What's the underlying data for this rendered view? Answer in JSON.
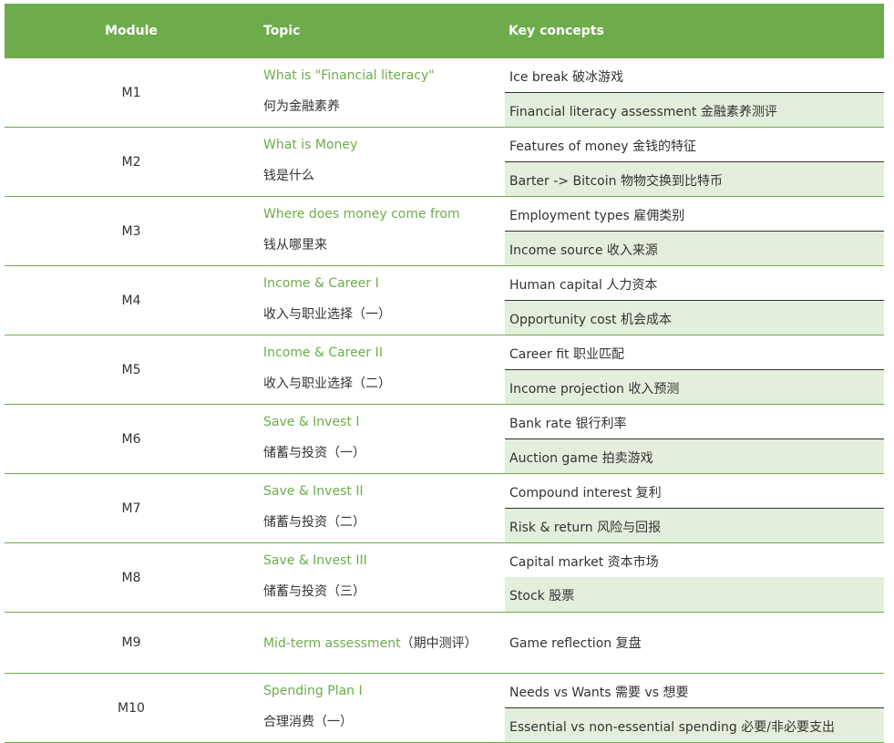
{
  "header": {
    "module": "Module",
    "topic": "Topic",
    "concepts": "Key concepts"
  },
  "rows": [
    {
      "module": "M1",
      "topic_en": "What is \"Financial literacy\"",
      "topic_zh": "何为金融素养",
      "concept1": "Ice break 破冰游戏",
      "concept2": "Financial literacy assessment 金融素养测评"
    },
    {
      "module": "M2",
      "topic_en": "What is Money",
      "topic_zh": "钱是什么",
      "concept1": "Features of money 金钱的特征",
      "concept2": "Barter -> Bitcoin 物物交换到比特币"
    },
    {
      "module": "M3",
      "topic_en": "Where does money come from",
      "topic_zh": "钱从哪里来",
      "concept1": "Employment types 雇佣类别",
      "concept2": "Income source 收入来源"
    },
    {
      "module": "M4",
      "topic_en": "Income & Career I",
      "topic_zh": "收入与职业选择（一）",
      "concept1": "Human capital 人力资本",
      "concept2": "Opportunity cost 机会成本"
    },
    {
      "module": "M5",
      "topic_en": "Income & Career II",
      "topic_zh": "收入与职业选择（二）",
      "concept1": "Career fit 职业匹配",
      "concept2": "Income projection 收入预测"
    },
    {
      "module": "M6",
      "topic_en": "Save & Invest I",
      "topic_zh": "储蓄与投资（一）",
      "concept1": "Bank rate 银行利率",
      "concept2": "Auction game 拍卖游戏"
    },
    {
      "module": "M7",
      "topic_en": "Save & Invest II",
      "topic_zh": "储蓄与投资（二）",
      "concept1": "Compound interest 复利",
      "concept2": "Risk & return 风险与回报"
    },
    {
      "module": "M8",
      "topic_en": "Save & Invest III",
      "topic_zh": "储蓄与投资（三）",
      "concept1": "Capital market 资本市场",
      "concept2": "Stock 股票"
    },
    {
      "module": "M9",
      "topic_en": "Mid-term assessment",
      "topic_zh": "（期中测评）",
      "concept1": "Game reflection 复盘"
    },
    {
      "module": "M10",
      "topic_en": "Spending Plan I",
      "topic_zh": "合理消费（一）",
      "concept1": "Needs vs Wants 需要 vs 想要",
      "concept2": "Essential vs non-essential spending 必要/非必要支出"
    }
  ],
  "colors": {
    "accent": "#6eac4b",
    "shade": "#e3eedc",
    "text": "#333333"
  }
}
